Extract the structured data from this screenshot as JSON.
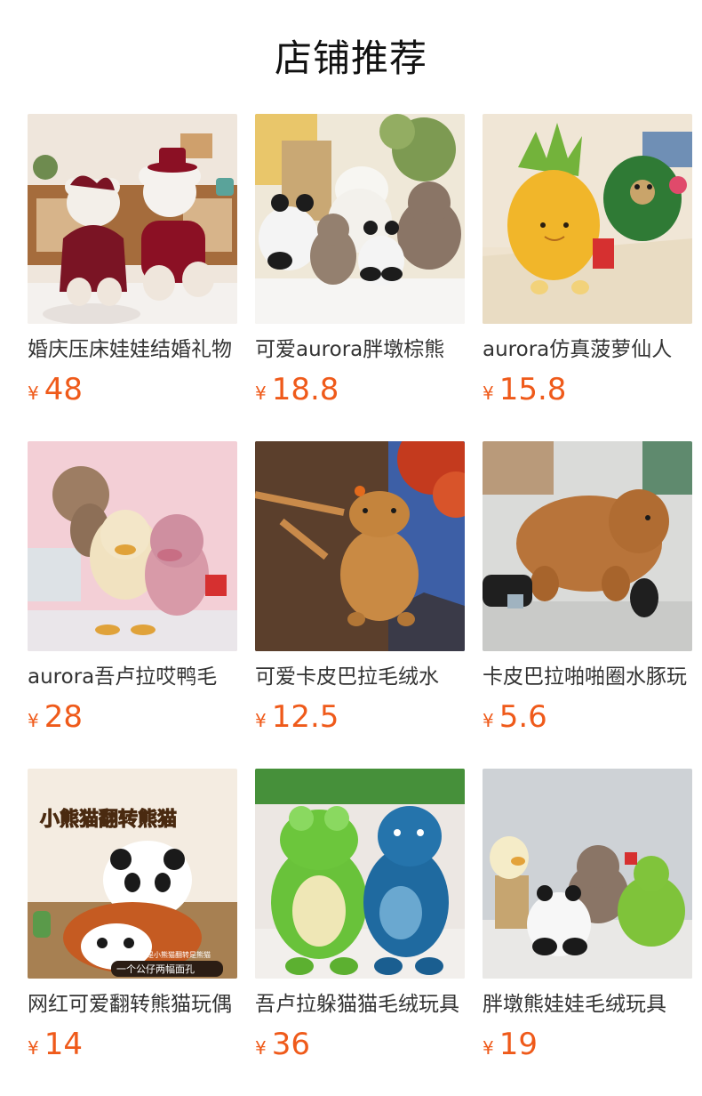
{
  "header": {
    "title": "店铺推荐"
  },
  "products": [
    {
      "title": "婚庆压床娃娃结婚礼物",
      "currency": "¥",
      "price": "48",
      "image": "wedding-bears-photo"
    },
    {
      "title": "可爱aurora胖墩棕熊",
      "currency": "¥",
      "price": "18.8",
      "image": "panda-bear-plush-photo"
    },
    {
      "title": "aurora仿真菠萝仙人",
      "currency": "¥",
      "price": "15.8",
      "image": "pineapple-plush-photo"
    },
    {
      "title": "aurora吾卢拉哎鸭毛",
      "currency": "¥",
      "price": "28",
      "image": "fluffy-birds-photo"
    },
    {
      "title": "可爱卡皮巴拉毛绒水",
      "currency": "¥",
      "price": "12.5",
      "image": "capybara-bag-photo"
    },
    {
      "title": "卡皮巴拉啪啪圈水豚玩",
      "currency": "¥",
      "price": "5.6",
      "image": "capybara-slap-band-photo"
    },
    {
      "title": "网红可爱翻转熊猫玩偶",
      "currency": "¥",
      "price": "14",
      "image": "reversible-panda-photo",
      "image_text": {
        "banner": "小熊猫翻转熊猫",
        "caption_top": "一面是小熊猫翻转是熊猫",
        "caption_bottom": "一个公仔两幅面孔"
      }
    },
    {
      "title": "吾卢拉躲猫猫毛绒玩具",
      "currency": "¥",
      "price": "36",
      "image": "frog-dino-plush-photo"
    },
    {
      "title": "胖墩熊娃娃毛绒玩具",
      "currency": "¥",
      "price": "19",
      "image": "chubby-animals-photo"
    }
  ]
}
